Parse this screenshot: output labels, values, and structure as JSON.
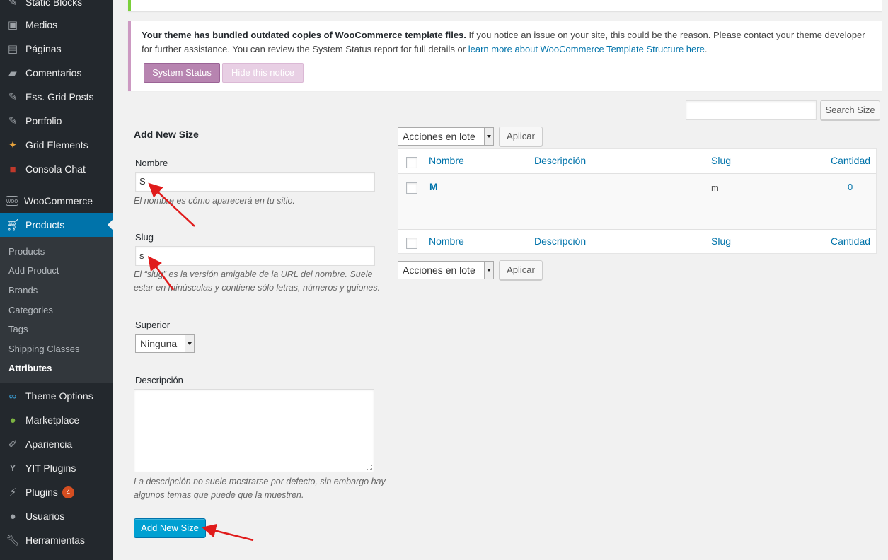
{
  "sidebar": {
    "items": [
      {
        "label": "Static Blocks",
        "icon": "pin-icon"
      },
      {
        "label": "Medios",
        "icon": "media-icon"
      },
      {
        "label": "Páginas",
        "icon": "page-icon"
      },
      {
        "label": "Comentarios",
        "icon": "comment-icon"
      },
      {
        "label": "Ess. Grid Posts",
        "icon": "pin-icon"
      },
      {
        "label": "Portfolio",
        "icon": "pin-icon"
      },
      {
        "label": "Grid Elements",
        "icon": "grid-elements-icon"
      },
      {
        "label": "Consola Chat",
        "icon": "chat-console-icon"
      },
      {
        "label": "WooCommerce",
        "icon": "woo-icon"
      },
      {
        "label": "Products",
        "icon": "cart-icon"
      },
      {
        "label": "Theme Options",
        "icon": "infinity-icon"
      },
      {
        "label": "Marketplace",
        "icon": "marketplace-icon"
      },
      {
        "label": "Apariencia",
        "icon": "brush-icon"
      },
      {
        "label": "YIT Plugins",
        "icon": "yit-icon"
      },
      {
        "label": "Plugins",
        "icon": "plugin-icon",
        "badge": "4"
      },
      {
        "label": "Usuarios",
        "icon": "user-icon"
      },
      {
        "label": "Herramientas",
        "icon": "wrench-icon"
      }
    ],
    "submenu": [
      "Products",
      "Add Product",
      "Brands",
      "Categories",
      "Tags",
      "Shipping Classes",
      "Attributes"
    ]
  },
  "notice": {
    "bold": "Your theme has bundled outdated copies of WooCommerce template files.",
    "text": " If you notice an issue on your site, this could be the reason. Please contact your theme developer for further assistance. You can review the System Status report for full details or ",
    "link": "learn more about WooCommerce Template Structure here",
    "end": ".",
    "system_status": "System Status",
    "hide": "Hide this notice"
  },
  "search": {
    "button": "Search Size",
    "value": ""
  },
  "form": {
    "heading": "Add New Size",
    "name_label": "Nombre",
    "name_value": "S",
    "name_help": "El nombre es cómo aparecerá en tu sitio.",
    "slug_label": "Slug",
    "slug_value": "s",
    "slug_help": "El “slug” es la versión amigable de la URL del nombre. Suele estar en minúsculas y contiene sólo letras, números y guiones.",
    "parent_label": "Superior",
    "parent_value": "Ninguna",
    "desc_label": "Descripción",
    "desc_help": "La descripción no suele mostrarse por defecto, sin embargo hay algunos temas que puede que la muestren.",
    "submit": "Add New Size"
  },
  "bulk": {
    "select": "Acciones en lote",
    "apply": "Aplicar"
  },
  "table": {
    "columns": [
      "Nombre",
      "Descripción",
      "Slug",
      "Cantidad"
    ],
    "rows": [
      {
        "name": "M",
        "description": "",
        "slug": "m",
        "count": "0"
      }
    ]
  },
  "colors": {
    "sidebar": "#23282d",
    "active": "#0073aa",
    "annotation": "#e01b1b"
  }
}
